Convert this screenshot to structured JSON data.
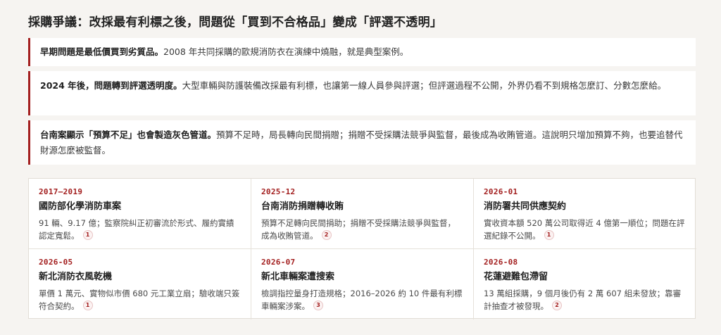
{
  "heading": "採購爭議：改採最有利標之後，問題從「買到不合格品」變成「評選不透明」",
  "callouts": [
    {
      "lead": "早期問題是最低價買到劣質品。",
      "text": "2008 年共同採購的歐規消防衣在演練中燒融，就是典型案例。"
    },
    {
      "lead": "2024 年後，問題轉到評選透明度。",
      "text": "大型車輛與防護裝備改採最有利標，也讓第一線人員參與評選；但評選過程不公開，外界仍看不到規格怎麼訂、分數怎麼給。"
    },
    {
      "lead": "台南案顯示「預算不足」也會製造灰色管道。",
      "text": "預算不足時，局長轉向民間捐贈；捐贈不受採購法競爭與監督，最後成為收賄管道。這說明只增加預算不夠，也要追替代財源怎麼被監督。"
    }
  ],
  "cases": [
    {
      "date": "2017–2019",
      "title": "國防部化學消防車案",
      "desc": "91 輛、9.17 億；監察院糾正初審流於形式、履約實績認定寬鬆。",
      "ref": "1"
    },
    {
      "date": "2025-12",
      "title": "台南消防捐贈轉收賄",
      "desc": "預算不足轉向民間捐助；捐贈不受採購法競爭與監督，成為收賄管道。",
      "ref": "2"
    },
    {
      "date": "2026-01",
      "title": "消防署共同供應契約",
      "desc": "實收資本額 520 萬公司取得近 4 億第一順位；問題在評選紀錄不公開。",
      "ref": "1"
    },
    {
      "date": "2026-05",
      "title": "新北消防衣風乾機",
      "desc": "單價 1 萬元、實物似市價 680 元工業立扇；驗收端只簽符合契約。",
      "ref": "1"
    },
    {
      "date": "2026-07",
      "title": "新北車輛案遭搜索",
      "desc": "檢調指控量身打造規格；2016–2026 約 10 件最有利標車輛案涉案。",
      "ref": "3"
    },
    {
      "date": "2026-08",
      "title": "花蓮避難包滯留",
      "desc": "13 萬組採購，9 個月後仍有 2 萬 607 組未發放；靠審計抽查才被發現。",
      "ref": "2"
    }
  ]
}
